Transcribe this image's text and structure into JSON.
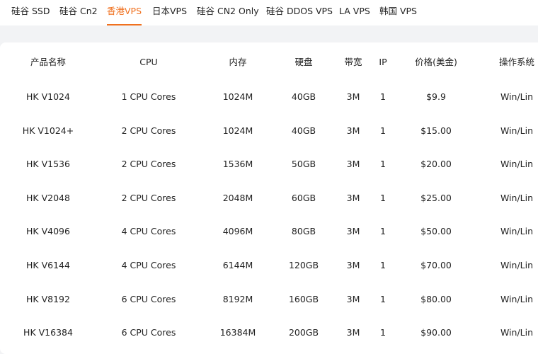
{
  "tabs": [
    {
      "label": "硅谷 SSD",
      "active": false
    },
    {
      "label": "硅谷 Cn2",
      "active": false
    },
    {
      "label": "香港VPS",
      "active": true
    },
    {
      "label": "日本VPS",
      "active": false
    },
    {
      "label": "硅谷 CN2 Only",
      "active": false
    },
    {
      "label": "硅谷 DDOS VPS",
      "active": false
    },
    {
      "label": "LA VPS",
      "active": false
    },
    {
      "label": "韩国 VPS",
      "active": false
    }
  ],
  "accent_color": "#f0701e",
  "table": {
    "headers": [
      "产品名称",
      "CPU",
      "内存",
      "硬盘",
      "带宽",
      "IP",
      "价格(美金)",
      "操作系统"
    ],
    "rows": [
      [
        "HK V1024",
        "1 CPU Cores",
        "1024M",
        "40GB",
        "3M",
        "1",
        "$9.9",
        "Win/Lin"
      ],
      [
        "HK V1024+",
        "2 CPU Cores",
        "1024M",
        "40GB",
        "3M",
        "1",
        "$15.00",
        "Win/Lin"
      ],
      [
        "HK V1536",
        "2 CPU Cores",
        "1536M",
        "50GB",
        "3M",
        "1",
        "$20.00",
        "Win/Lin"
      ],
      [
        "HK V2048",
        "2 CPU Cores",
        "2048M",
        "60GB",
        "3M",
        "1",
        "$25.00",
        "Win/Lin"
      ],
      [
        "HK V4096",
        "4 CPU Cores",
        "4096M",
        "80GB",
        "3M",
        "1",
        "$50.00",
        "Win/Lin"
      ],
      [
        "HK V6144",
        "4 CPU Cores",
        "6144M",
        "120GB",
        "3M",
        "1",
        "$70.00",
        "Win/Lin"
      ],
      [
        "HK V8192",
        "6 CPU Cores",
        "8192M",
        "160GB",
        "3M",
        "1",
        "$80.00",
        "Win/Lin"
      ],
      [
        "HK V16384",
        "6 CPU Cores",
        "16384M",
        "200GB",
        "3M",
        "1",
        "$90.00",
        "Win/Lin"
      ]
    ]
  }
}
